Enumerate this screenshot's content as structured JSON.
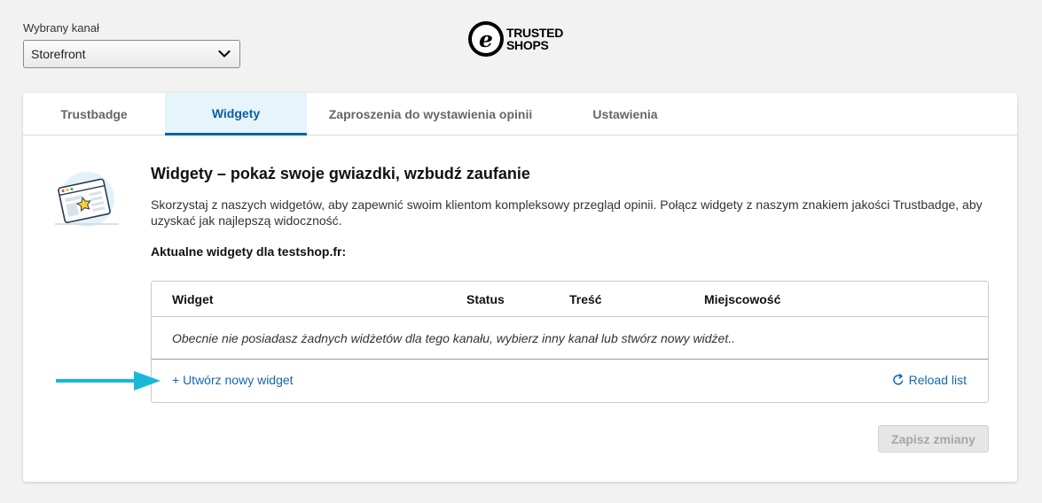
{
  "channel": {
    "label": "Wybrany kanał",
    "selected": "Storefront"
  },
  "logo": {
    "glyph": "e",
    "line1": "TRUSTED",
    "line2": "SHOPS"
  },
  "tabs": [
    {
      "label": "Trustbadge",
      "active": false
    },
    {
      "label": "Widgety",
      "active": true
    },
    {
      "label": "Zaproszenia do wystawienia opinii",
      "active": false
    },
    {
      "label": "Ustawienia",
      "active": false
    }
  ],
  "content": {
    "heading": "Widgety – pokaż swoje gwiazdki, wzbudź zaufanie",
    "description": "Skorzystaj z naszych widgetów, aby zapewnić swoim klientom kompleksowy przegląd opinii. Połącz widgety z naszym znakiem jakości Trustbadge, aby uzyskać jak najlepszą widoczność.",
    "current_label": "Aktualne widgety dla testshop.fr:"
  },
  "widgets_table": {
    "columns": [
      "Widget",
      "Status",
      "Treść",
      "Miejscowość"
    ],
    "empty_message": "Obecnie nie posiadasz żadnych widżetów dla tego kanału, wybierz inny kanał lub stwórz nowy widżet..",
    "create_link": "+ Utwórz nowy widget",
    "reload_link": "Reload list"
  },
  "save_button": {
    "label": "Zapisz zmiany",
    "disabled": true
  },
  "icons": {
    "select_chevron": "chevron-down-icon",
    "reload": "reload-icon",
    "illustration": "browser-star-illustration",
    "annotation_arrow": "arrow-right-icon"
  },
  "colors": {
    "accent_blue": "#0a62a8",
    "link_blue": "#1565b0",
    "active_tab_bg": "#e6f4fb",
    "annotation_arrow": "#1ab8d6"
  }
}
